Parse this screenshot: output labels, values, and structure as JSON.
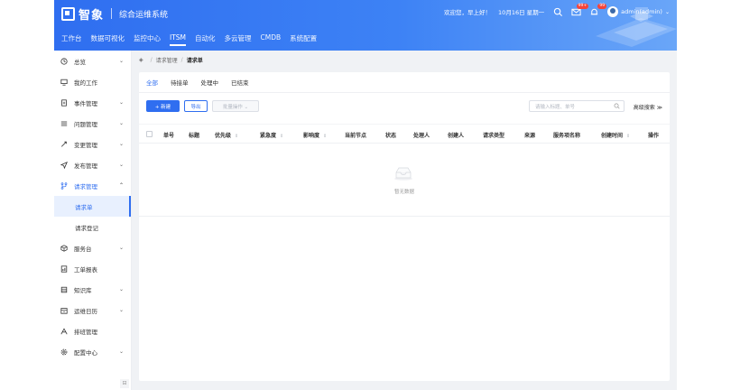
{
  "header": {
    "brand_name": "智象",
    "brand_sub": "综合运维系统",
    "greeting": "欢迎您，早上好！",
    "date": "10月16日 星期一",
    "mail_badge": "99+",
    "notice_badge": "99",
    "user": "admin(admin)",
    "nav": [
      "工作台",
      "数据可视化",
      "监控中心",
      "ITSM",
      "自动化",
      "多云管理",
      "CMDB",
      "系统配置"
    ],
    "active_nav": "ITSM"
  },
  "sidebar": {
    "items": [
      {
        "label": "总览",
        "icon": "clock-icon",
        "chevron": "⌄"
      },
      {
        "label": "我的工作",
        "icon": "monitor-icon",
        "chevron": ""
      },
      {
        "label": "事件管理",
        "icon": "document-icon",
        "chevron": "⌄"
      },
      {
        "label": "问题管理",
        "icon": "list-icon",
        "chevron": "⌄"
      },
      {
        "label": "变更管理",
        "icon": "arrows-icon",
        "chevron": "⌄"
      },
      {
        "label": "发布管理",
        "icon": "send-icon",
        "chevron": "⌄"
      },
      {
        "label": "请求管理",
        "icon": "branch-icon",
        "chevron": "⌃"
      }
    ],
    "sub_items": [
      "请求单",
      "请求登记"
    ],
    "items_after": [
      {
        "label": "服务台",
        "icon": "cube-icon",
        "chevron": "⌄"
      },
      {
        "label": "工单报表",
        "icon": "report-icon",
        "chevron": ""
      },
      {
        "label": "知识库",
        "icon": "book-icon",
        "chevron": "⌄"
      },
      {
        "label": "运维日历",
        "icon": "calendar-icon",
        "chevron": "⌄"
      },
      {
        "label": "排班管理",
        "icon": "people-icon",
        "chevron": ""
      },
      {
        "label": "配置中心",
        "icon": "gear-icon",
        "chevron": "⌄"
      }
    ]
  },
  "breadcrumb": {
    "parent": "请求管理",
    "current": "请求单"
  },
  "tabs": [
    "全部",
    "待接单",
    "处理中",
    "已结束"
  ],
  "toolbar": {
    "new_label": "+ 新建",
    "export_label": "导出",
    "batch_label": "批量操作 ⌄"
  },
  "search": {
    "placeholder": "请输入标题、单号",
    "advanced": "高级搜索 ≫"
  },
  "table": {
    "columns": [
      "单号",
      "标题",
      "优先级",
      "紧急度",
      "影响度",
      "当前节点",
      "状态",
      "处理人",
      "创建人",
      "请求类型",
      "来源",
      "服务项名称",
      "创建时间",
      "操作"
    ],
    "empty_text": "暂无数据"
  },
  "colors": {
    "primary": "#2f6ef0",
    "header_start": "#2f6ef0",
    "header_end": "#6aa6f8"
  }
}
